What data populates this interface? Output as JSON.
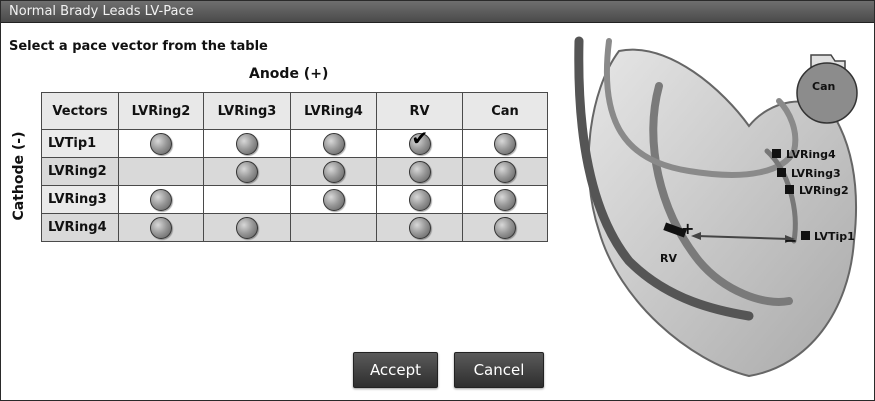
{
  "window": {
    "title": "Normal Brady Leads LV-Pace"
  },
  "instruction": "Select a pace vector from the table",
  "table": {
    "anode_label": "Anode (+)",
    "cathode_label": "Cathode (-)",
    "columns": [
      "Vectors",
      "LVRing2",
      "LVRing3",
      "LVRing4",
      "RV",
      "Can"
    ],
    "rows": [
      {
        "label": "LVTip1",
        "cells": [
          true,
          true,
          true,
          "selected",
          true
        ]
      },
      {
        "label": "LVRing2",
        "cells": [
          false,
          true,
          true,
          true,
          true
        ]
      },
      {
        "label": "LVRing3",
        "cells": [
          true,
          false,
          true,
          true,
          true
        ]
      },
      {
        "label": "LVRing4",
        "cells": [
          true,
          true,
          false,
          true,
          true
        ]
      }
    ]
  },
  "diagram": {
    "can_label": "Can",
    "lead_labels": [
      "LVRing4",
      "LVRing3",
      "LVRing2",
      "LVTip1"
    ],
    "rv_label": "RV",
    "plus": "+",
    "minus": "−"
  },
  "buttons": {
    "accept": "Accept",
    "cancel": "Cancel"
  }
}
